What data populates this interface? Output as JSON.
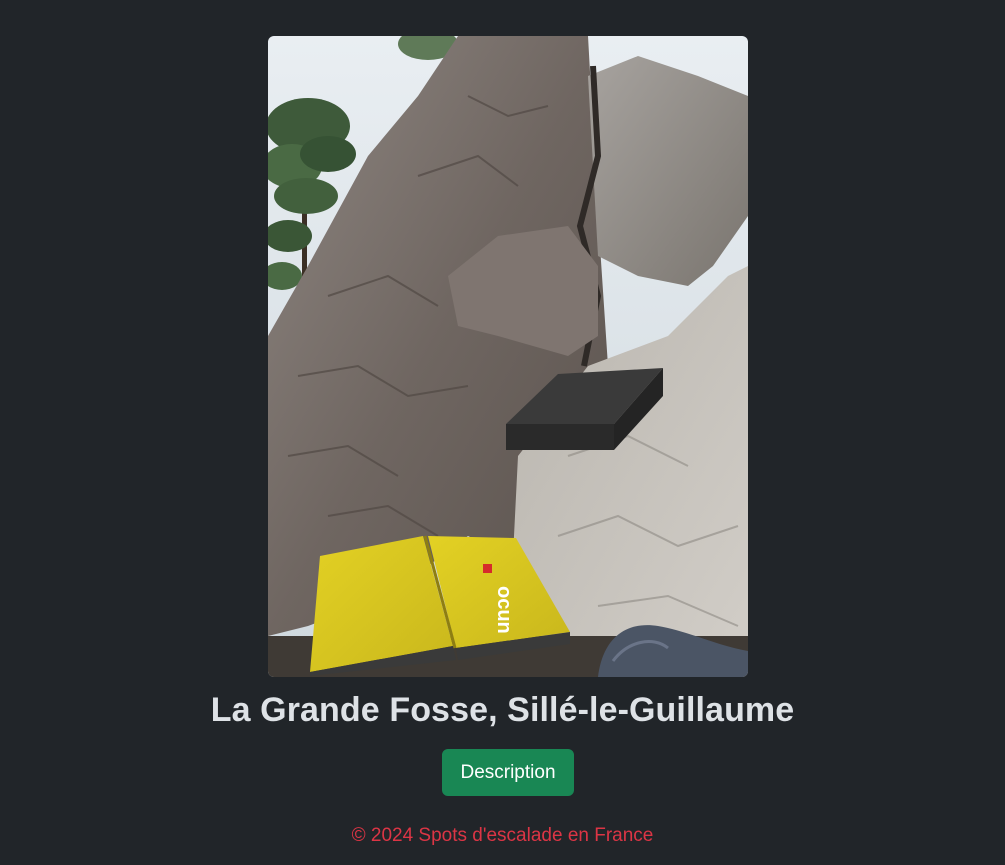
{
  "photo": {
    "alt": "La Grande Fosse, Sillé-le-Guillaume",
    "mat_brand": "ocun"
  },
  "spot": {
    "title": "La Grande Fosse, Sillé-le-Guillaume"
  },
  "actions": {
    "description_label": "Description"
  },
  "footer": {
    "copyright": "© 2024 Spots d'escalade en France"
  },
  "colors": {
    "background": "#212529",
    "text": "#dee2e6",
    "button": "#198754",
    "footer_text": "#dc3545"
  }
}
